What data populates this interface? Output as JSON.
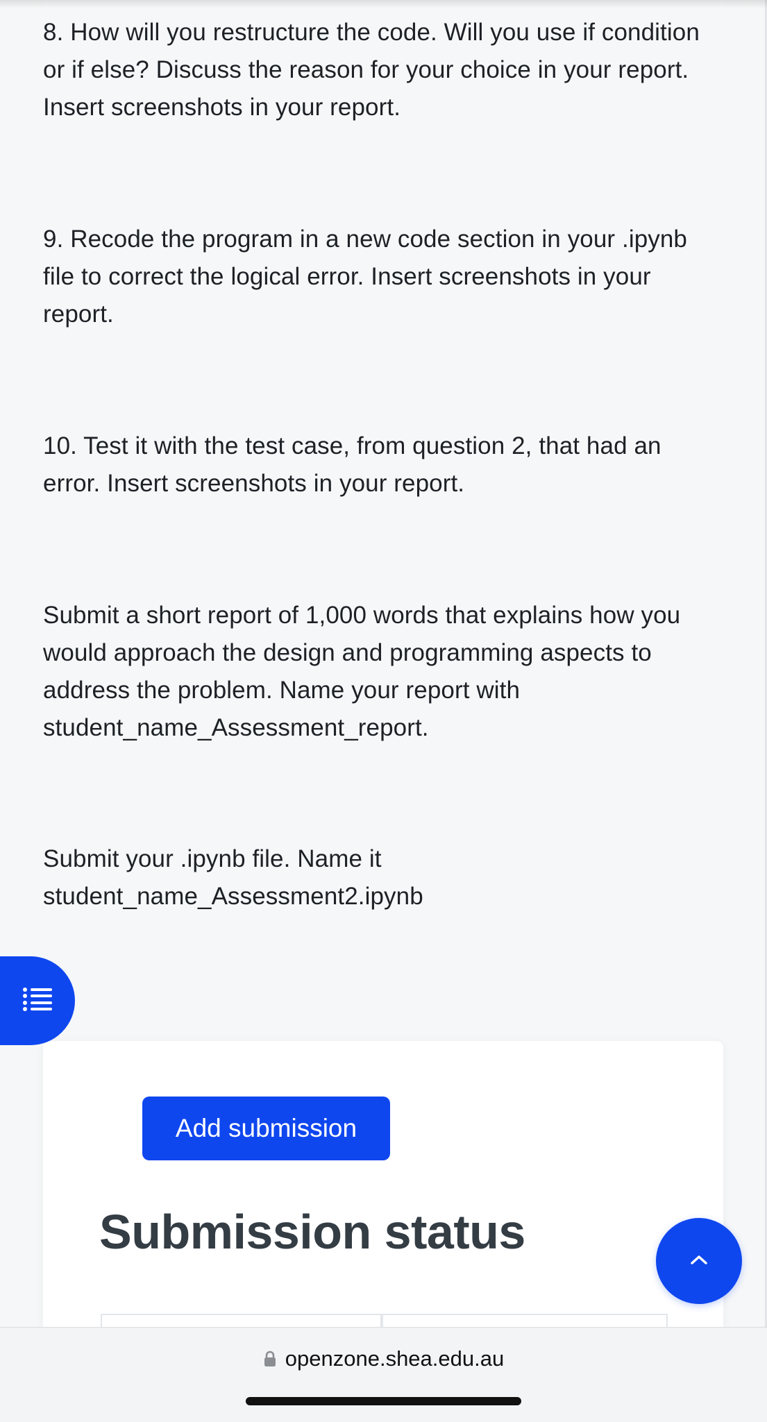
{
  "content": {
    "q8": "8. How will you restructure the code. Will you use if condition or if else? Discuss the reason for your choice in your report.  Insert screenshots in your report.",
    "q9": "9. Recode the program in a new code section in your .ipynb file to correct the logical error.  Insert screenshots in your report.",
    "q10": "10. Test it with the test case, from question 2, that had an error. Insert screenshots in your report.",
    "report_instructions": "Submit a short report of 1,000 words that explains how you would approach the design and programming aspects to address the problem. Name your report with student_name_Assessment_report.",
    "file_instructions": "Submit your .ipynb file. Name it student_name_Assessment2.ipynb"
  },
  "submission": {
    "add_button_label": "Add submission",
    "status_heading": "Submission status"
  },
  "floating_buttons": {
    "index_icon": "list-icon",
    "back_to_top_icon": "chevron-up-icon"
  },
  "browser": {
    "url": "openzone.shea.edu.au",
    "secure_icon": "lock-icon"
  },
  "colors": {
    "accent": "#0f47ef",
    "text": "#1d2125",
    "heading": "#343c44",
    "content_bg": "#f5f7f9"
  }
}
